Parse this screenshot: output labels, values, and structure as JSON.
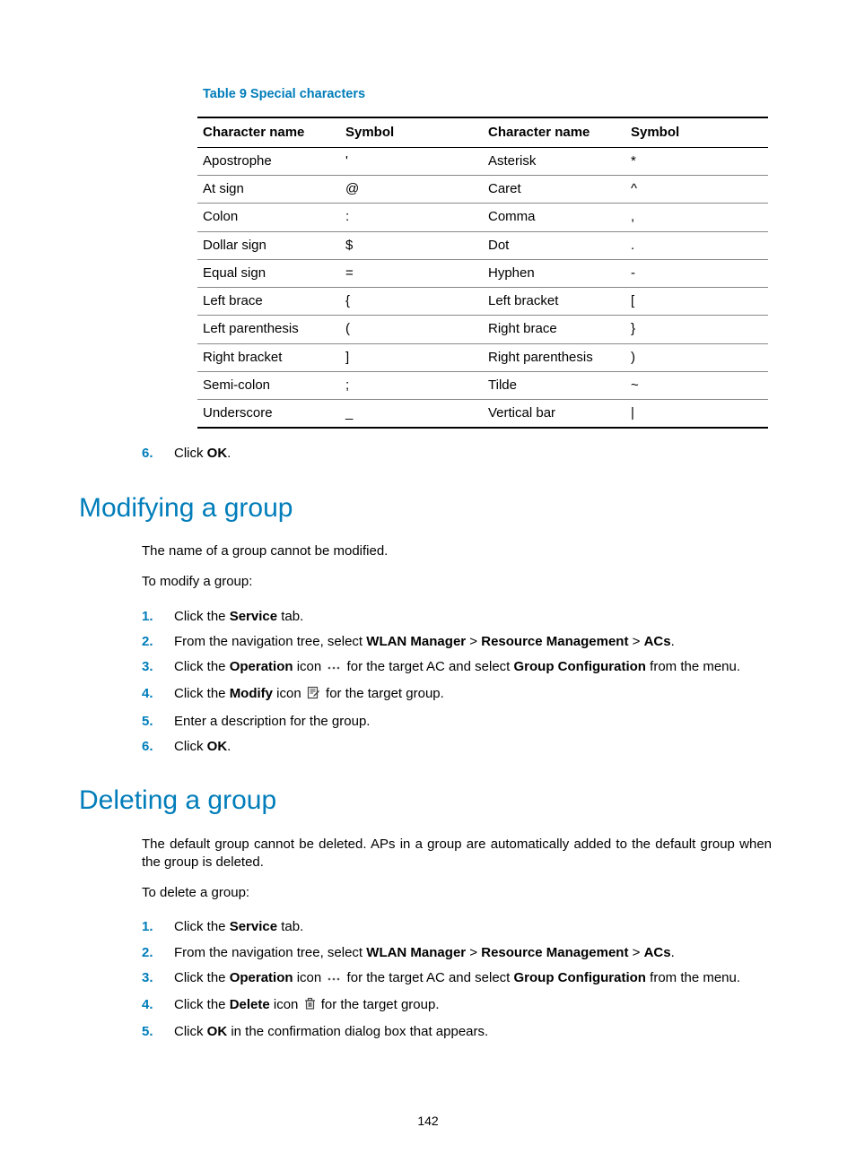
{
  "page_number": "142",
  "table": {
    "caption": "Table 9 Special characters",
    "headers": [
      "Character name",
      "Symbol",
      "Character name",
      "Symbol"
    ],
    "rows": [
      [
        "Apostrophe",
        "'",
        "Asterisk",
        "*"
      ],
      [
        "At sign",
        "@",
        "Caret",
        "^"
      ],
      [
        "Colon",
        ":",
        "Comma",
        ","
      ],
      [
        "Dollar sign",
        "$",
        "Dot",
        "."
      ],
      [
        "Equal sign",
        "=",
        "Hyphen",
        "-"
      ],
      [
        "Left brace",
        "{",
        "Left bracket",
        "["
      ],
      [
        "Left parenthesis",
        "(",
        "Right brace",
        "}"
      ],
      [
        "Right bracket",
        "]",
        "Right parenthesis",
        ")"
      ],
      [
        "Semi-colon",
        ";",
        "Tilde",
        "~"
      ],
      [
        "Underscore",
        "_",
        "Vertical bar",
        "|"
      ]
    ]
  },
  "step6": {
    "num": "6.",
    "prefix": "Click ",
    "bold": "OK",
    "suffix": "."
  },
  "modify": {
    "heading": "Modifying a group",
    "intro1": "The name of a group cannot be modified.",
    "intro2": "To modify a group:",
    "steps": [
      {
        "num": "1.",
        "pre": "Click the ",
        "b1": "Service",
        "post": " tab."
      },
      {
        "num": "2.",
        "pre": "From the navigation tree, select ",
        "b1": "WLAN Manager",
        "sep1": " > ",
        "b2": "Resource Management",
        "sep2": " > ",
        "b3": "ACs",
        "post": "."
      },
      {
        "num": "3.",
        "pre": "Click the ",
        "b1": "Operation",
        "mid": " icon ",
        "icon": "ellipsis",
        "post2": " for the target AC and select ",
        "b2": "Group Configuration",
        "post3": " from the menu."
      },
      {
        "num": "4.",
        "pre": "Click the ",
        "b1": "Modify",
        "mid": " icon ",
        "icon": "modify",
        "post2": " for the target group."
      },
      {
        "num": "5.",
        "text": "Enter a description for the group."
      },
      {
        "num": "6.",
        "pre": "Click ",
        "b1": "OK",
        "post": "."
      }
    ]
  },
  "del": {
    "heading": "Deleting a group",
    "intro1": "The default group cannot be deleted. APs in a group are automatically added to the default group when the group is deleted.",
    "intro2": "To delete a group:",
    "steps": [
      {
        "num": "1.",
        "pre": "Click the ",
        "b1": "Service",
        "post": " tab."
      },
      {
        "num": "2.",
        "pre": "From the navigation tree, select ",
        "b1": "WLAN Manager",
        "sep1": " > ",
        "b2": "Resource Management",
        "sep2": " > ",
        "b3": "ACs",
        "post": "."
      },
      {
        "num": "3.",
        "pre": "Click the ",
        "b1": "Operation",
        "mid": " icon ",
        "icon": "ellipsis",
        "post2": " for the target AC and select ",
        "b2": "Group Configuration",
        "post3": " from the menu."
      },
      {
        "num": "4.",
        "pre": "Click the ",
        "b1": "Delete",
        "mid": " icon ",
        "icon": "delete",
        "post2": " for the target group."
      },
      {
        "num": "5.",
        "pre": "Click ",
        "b1": "OK",
        "post": " in the confirmation dialog box that appears."
      }
    ]
  }
}
